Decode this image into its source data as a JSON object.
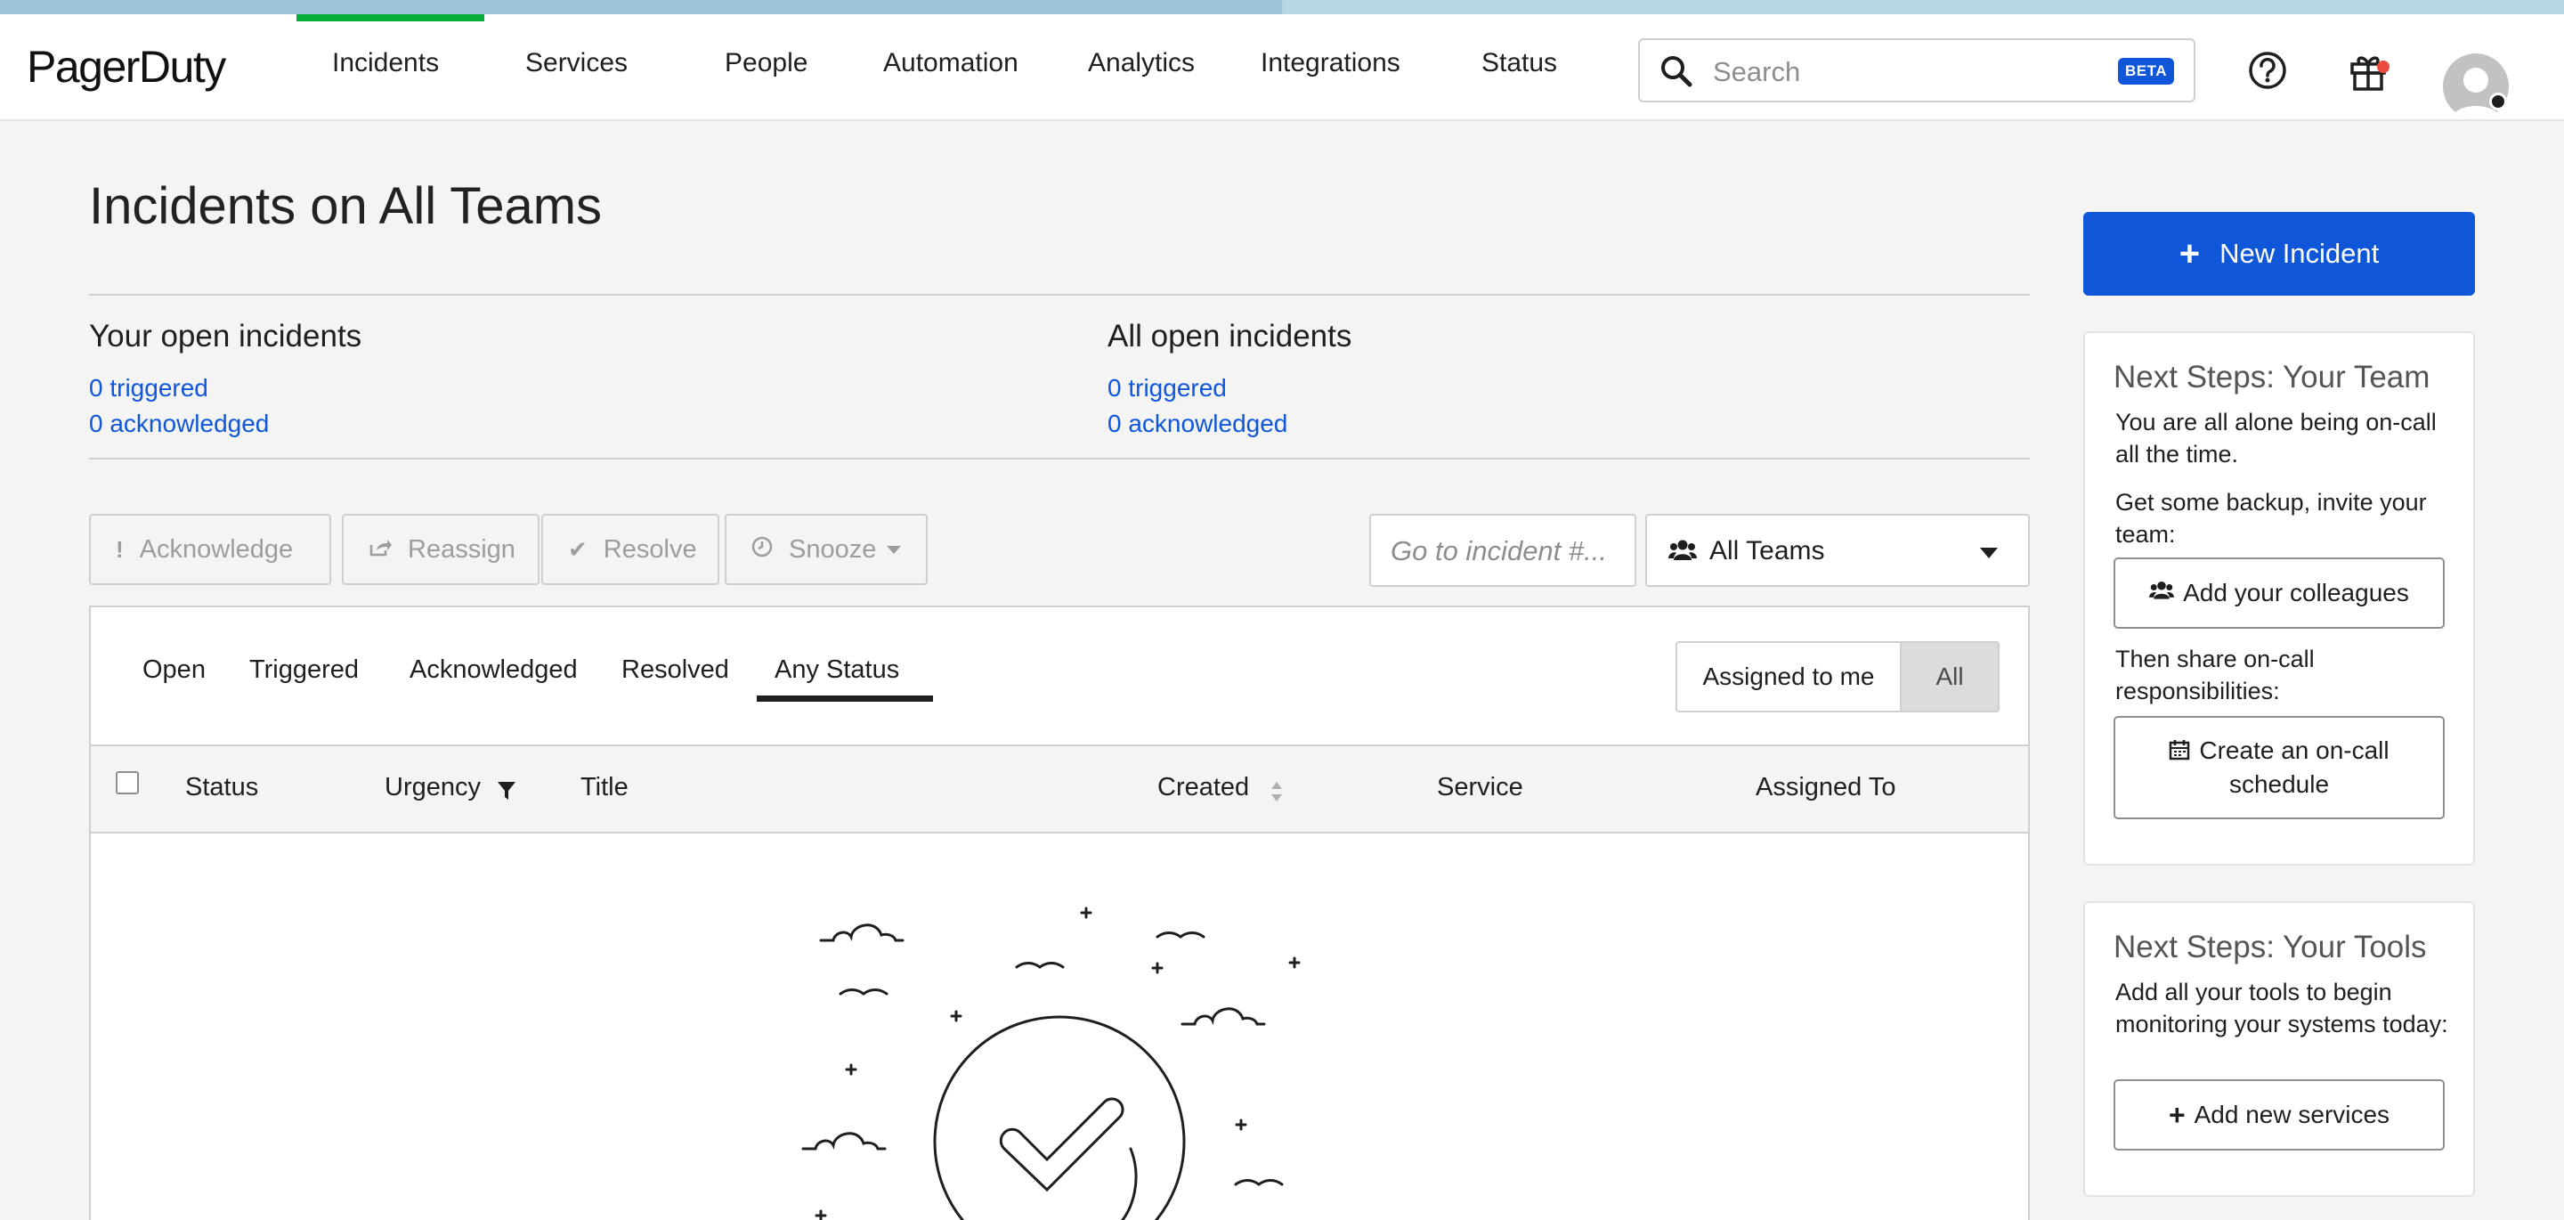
{
  "app": {
    "logo": "PagerDuty"
  },
  "nav": {
    "items": [
      {
        "label": "Incidents"
      },
      {
        "label": "Services"
      },
      {
        "label": "People"
      },
      {
        "label": "Automation"
      },
      {
        "label": "Analytics"
      },
      {
        "label": "Integrations"
      },
      {
        "label": "Status"
      }
    ],
    "active": "Incidents"
  },
  "search": {
    "placeholder": "Search",
    "badge": "BETA"
  },
  "header_icons": [
    "help-icon",
    "gift-icon",
    "avatar"
  ],
  "page": {
    "title": "Incidents on All Teams"
  },
  "your_open": {
    "title": "Your open incidents",
    "triggered": "0 triggered",
    "acknowledged": "0 acknowledged"
  },
  "all_open": {
    "title": "All open incidents",
    "triggered": "0 triggered",
    "acknowledged": "0 acknowledged"
  },
  "actions": {
    "acknowledge": "Acknowledge",
    "reassign": "Reassign",
    "resolve": "Resolve",
    "snooze": "Snooze",
    "goto_placeholder": "Go to incident #...",
    "team_select": "All Teams"
  },
  "tabs": [
    {
      "label": "Open"
    },
    {
      "label": "Triggered"
    },
    {
      "label": "Acknowledged"
    },
    {
      "label": "Resolved"
    },
    {
      "label": "Any Status"
    }
  ],
  "active_tab": "Any Status",
  "assign_filter": {
    "me": "Assigned to me",
    "all": "All",
    "selected": "All"
  },
  "table": {
    "columns": [
      "Status",
      "Urgency",
      "Title",
      "Created",
      "Service",
      "Assigned To"
    ],
    "rows": []
  },
  "sidebar": {
    "new_incident": "New Incident",
    "team_card": {
      "title": "Next Steps: Your Team",
      "text1": "You are all alone being on-call all the time.",
      "text2": "Get some backup, invite your team:",
      "btn1": "Add your colleagues",
      "text3": "Then share on-call responsibilities:",
      "btn2": "Create an on-call schedule"
    },
    "tools_card": {
      "title": "Next Steps: Your Tools",
      "text": "Add all your tools to begin monitoring your systems today:",
      "btn": "Add new services"
    }
  },
  "colors": {
    "primary": "#0f56d9",
    "active_nav": "#06ac38",
    "notification": "#eb4b3f"
  }
}
